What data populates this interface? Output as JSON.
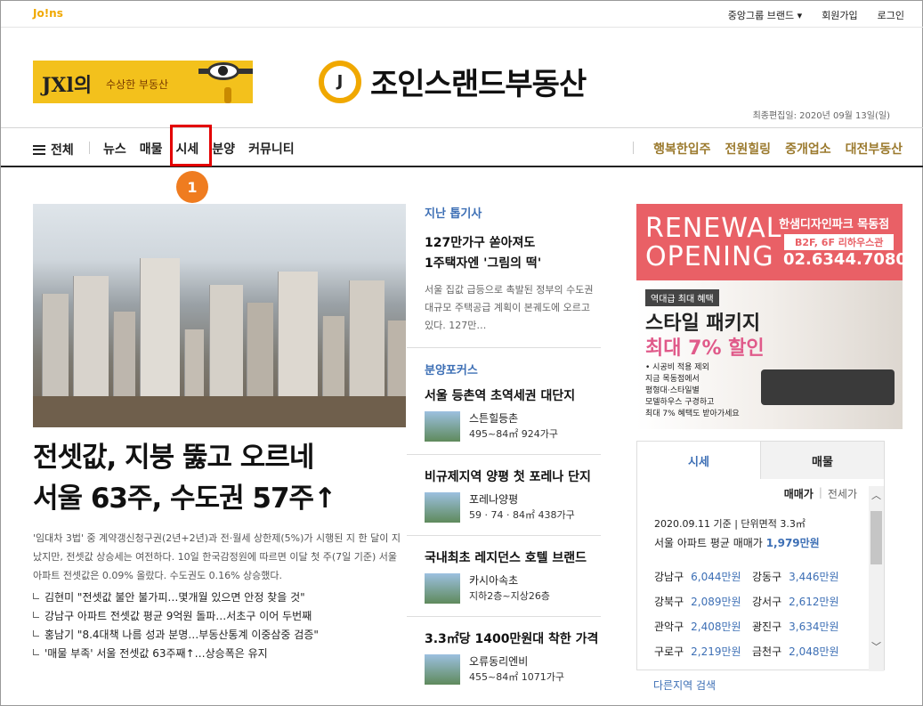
{
  "top": {
    "logo": "Jo!ns",
    "links": [
      "중앙그룹 브랜드 ▾",
      "회원가입",
      "로그인"
    ]
  },
  "header": {
    "banner_left_main": "JXl의",
    "banner_left_sub": "수상한 부동산",
    "site_logo_letter": "J",
    "site_title": "조인스랜드부동산",
    "edit_date": "최종편집일: 2020년 09월 13일(일)"
  },
  "nav": {
    "all_label": "전체",
    "items": [
      "뉴스",
      "매물",
      "시세",
      "분양",
      "커뮤니티"
    ],
    "right_items": [
      "행복한입주",
      "전원힐링",
      "중개업소",
      "대전부동산"
    ]
  },
  "annotation": {
    "step": "1"
  },
  "hero": {
    "title_line1": "전셋값, 지붕 뚫고 오르네",
    "title_line2": "서울 63주, 수도권 57주↑",
    "summary": "'임대차 3법' 중 계약갱신청구권(2년+2년)과 전·월세 상한제(5%)가 시행된 지 한 달이 지났지만, 전셋값 상승세는 여전하다. 10일 한국감정원에 따르면 이달 첫 주(7일 기준) 서울 아파트 전셋값은 0.09% 올랐다. 수도권도 0.16% 상승했다.",
    "related": [
      "김현미 \"전셋값 불안 불가피…몇개월 있으면 안정 찾을 것\"",
      "강남구 아파트 전셋값 평균 9억원 돌파…서초구 이어 두번째",
      "홍남기 \"8.4대책 나름 성과 분명…부동산통계 이중삼중 검증\"",
      "'매물 부족' 서울 전셋값 63주째↑…상승폭은 유지"
    ]
  },
  "middle": {
    "last_week_title": "지난 톱기사",
    "last_week_headline_1": "127만가구 쏟아져도",
    "last_week_headline_2": "1주택자엔 '그림의 떡'",
    "last_week_text": "서울 집값 급등으로 촉발된 정부의 수도권 대규모 주택공급 계획이 본궤도에 오르고 있다. 127만…",
    "focus_title": "분양포커스",
    "items": [
      {
        "title": "서울 등촌역 초역세권 대단지",
        "name": "스튼힐등촌",
        "info": "495~84㎡ 924가구"
      },
      {
        "title": "비규제지역 양평 첫 포레나 단지",
        "name": "포레나양평",
        "info": "59 · 74 · 84㎡ 438가구"
      },
      {
        "title": "국내최초 레지던스 호텔 브랜드",
        "name": "카시아속초",
        "info": "지하2층~지상26층"
      },
      {
        "title": "3.3㎡당 1400만원대 착한 가격",
        "name": "오류동리엔비",
        "info": "455~84㎡ 1071가구"
      }
    ]
  },
  "ad": {
    "renewal_1": "RENEWAL",
    "renewal_2": "OPENING",
    "brand": "한샘디자인파크 목동점",
    "floor": "B2F, 6F 리하우스관",
    "phone": "02.6344.7080",
    "tag": "역대급 최대 혜택",
    "package": "스타일 패키지",
    "discount": "최대 7% 할인",
    "small_1": "• 시공비 적용 제외",
    "small_2": "지금 목동점에서",
    "small_3": "평형대·스타일별",
    "small_4": "모델하우스 구경하고",
    "small_5": "최대 7% 혜택도 받아가세요"
  },
  "price_panel": {
    "tab_active": "시세",
    "tab_inactive": "매물",
    "subtab_1": "매매가",
    "subtab_sep": "|",
    "subtab_2": "전세가",
    "date": "2020.09.11 기준 | 단위면적 3.3㎡",
    "avg_label": "서울 아파트 평균 매매가",
    "avg_value": "1,979만원",
    "rows": [
      {
        "d1": "강남구",
        "v1": "6,044만원",
        "d2": "강동구",
        "v2": "3,446만원"
      },
      {
        "d1": "강북구",
        "v1": "2,089만원",
        "d2": "강서구",
        "v2": "2,612만원"
      },
      {
        "d1": "관악구",
        "v1": "2,408만원",
        "d2": "광진구",
        "v2": "3,634만원"
      },
      {
        "d1": "구로구",
        "v1": "2,219만원",
        "d2": "금천구",
        "v2": "2,048만원"
      }
    ],
    "more_link": "다른지역 검색"
  }
}
